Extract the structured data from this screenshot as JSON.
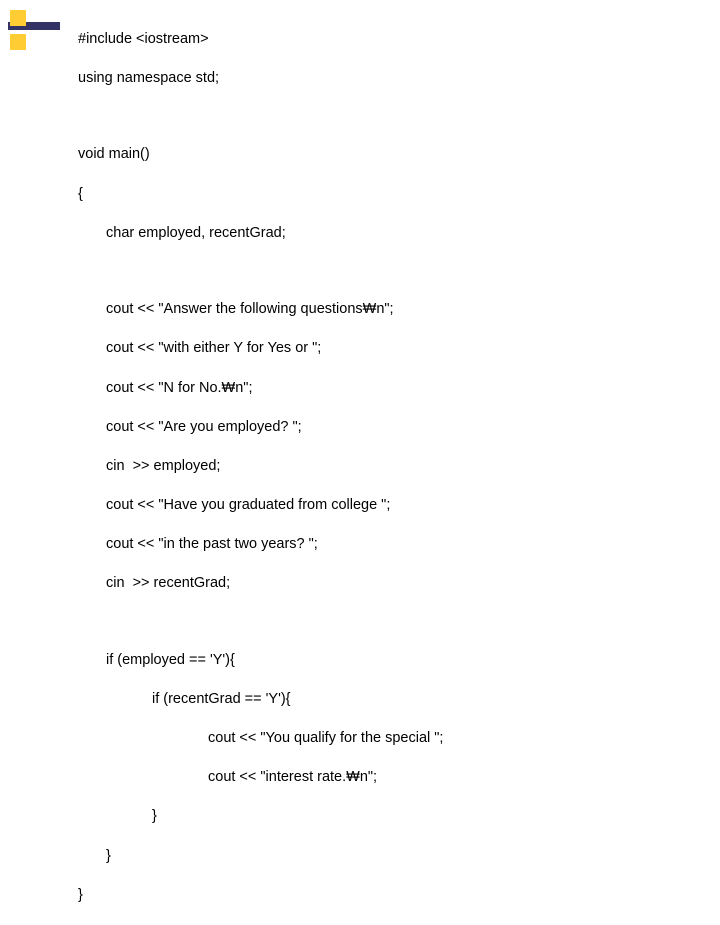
{
  "code": {
    "l1": "#include <iostream>",
    "l2": "using namespace std;",
    "l3": "void main()",
    "l4": "{",
    "l5": "char employed, recentGrad;",
    "l6": "cout << \"Answer the following questions₩n\";",
    "l7": "cout << \"with either Y for Yes or \";",
    "l8": "cout << \"N for No.₩n\";",
    "l9": "cout << \"Are you employed? \";",
    "l10": "cin  >> employed;",
    "l11": "cout << \"Have you graduated from college \";",
    "l12": "cout << \"in the past two years? \";",
    "l13": "cin  >> recentGrad;",
    "l14": "if (employed == 'Y'){",
    "l15": "if (recentGrad == 'Y'){",
    "l16": "cout << \"You qualify for the special \";",
    "l17": "cout << \"interest rate.₩n\";",
    "l18": "}",
    "l19": "}",
    "l20": "}"
  },
  "decor": {
    "bar_color": "#333366",
    "accent_color": "#ffcc33"
  }
}
